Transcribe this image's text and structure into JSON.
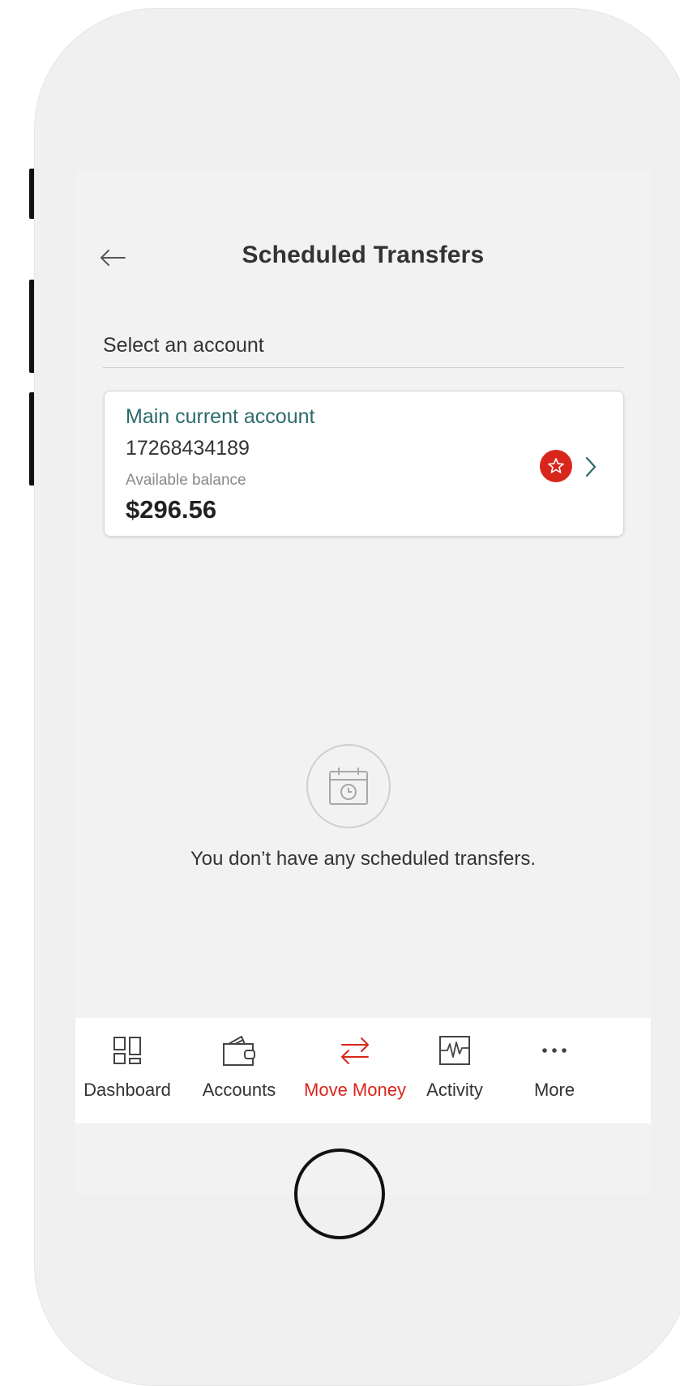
{
  "header": {
    "title": "Scheduled Transfers",
    "back_icon": "arrow-left-icon"
  },
  "account_select": {
    "label": "Select an account"
  },
  "account": {
    "name": "Main current account",
    "number": "17268434189",
    "balance_label": "Available balance",
    "balance": "$296.56",
    "badge_icon": "star-icon",
    "badge_color": "#d8261c",
    "name_color": "#2b6b6a"
  },
  "empty_state": {
    "icon": "calendar-clock-icon",
    "message": "You don’t have any scheduled transfers."
  },
  "tab_bar": {
    "active_color": "#d8261c",
    "tabs": [
      {
        "label": "Dashboard",
        "icon": "dashboard-grid-icon",
        "active": false
      },
      {
        "label": "Accounts",
        "icon": "wallet-icon",
        "active": false
      },
      {
        "label": "Move Money",
        "icon": "transfer-arrows-icon",
        "active": true
      },
      {
        "label": "Activity",
        "icon": "activity-chart-icon",
        "active": false
      },
      {
        "label": "More",
        "icon": "more-dots-icon",
        "active": false
      }
    ]
  }
}
